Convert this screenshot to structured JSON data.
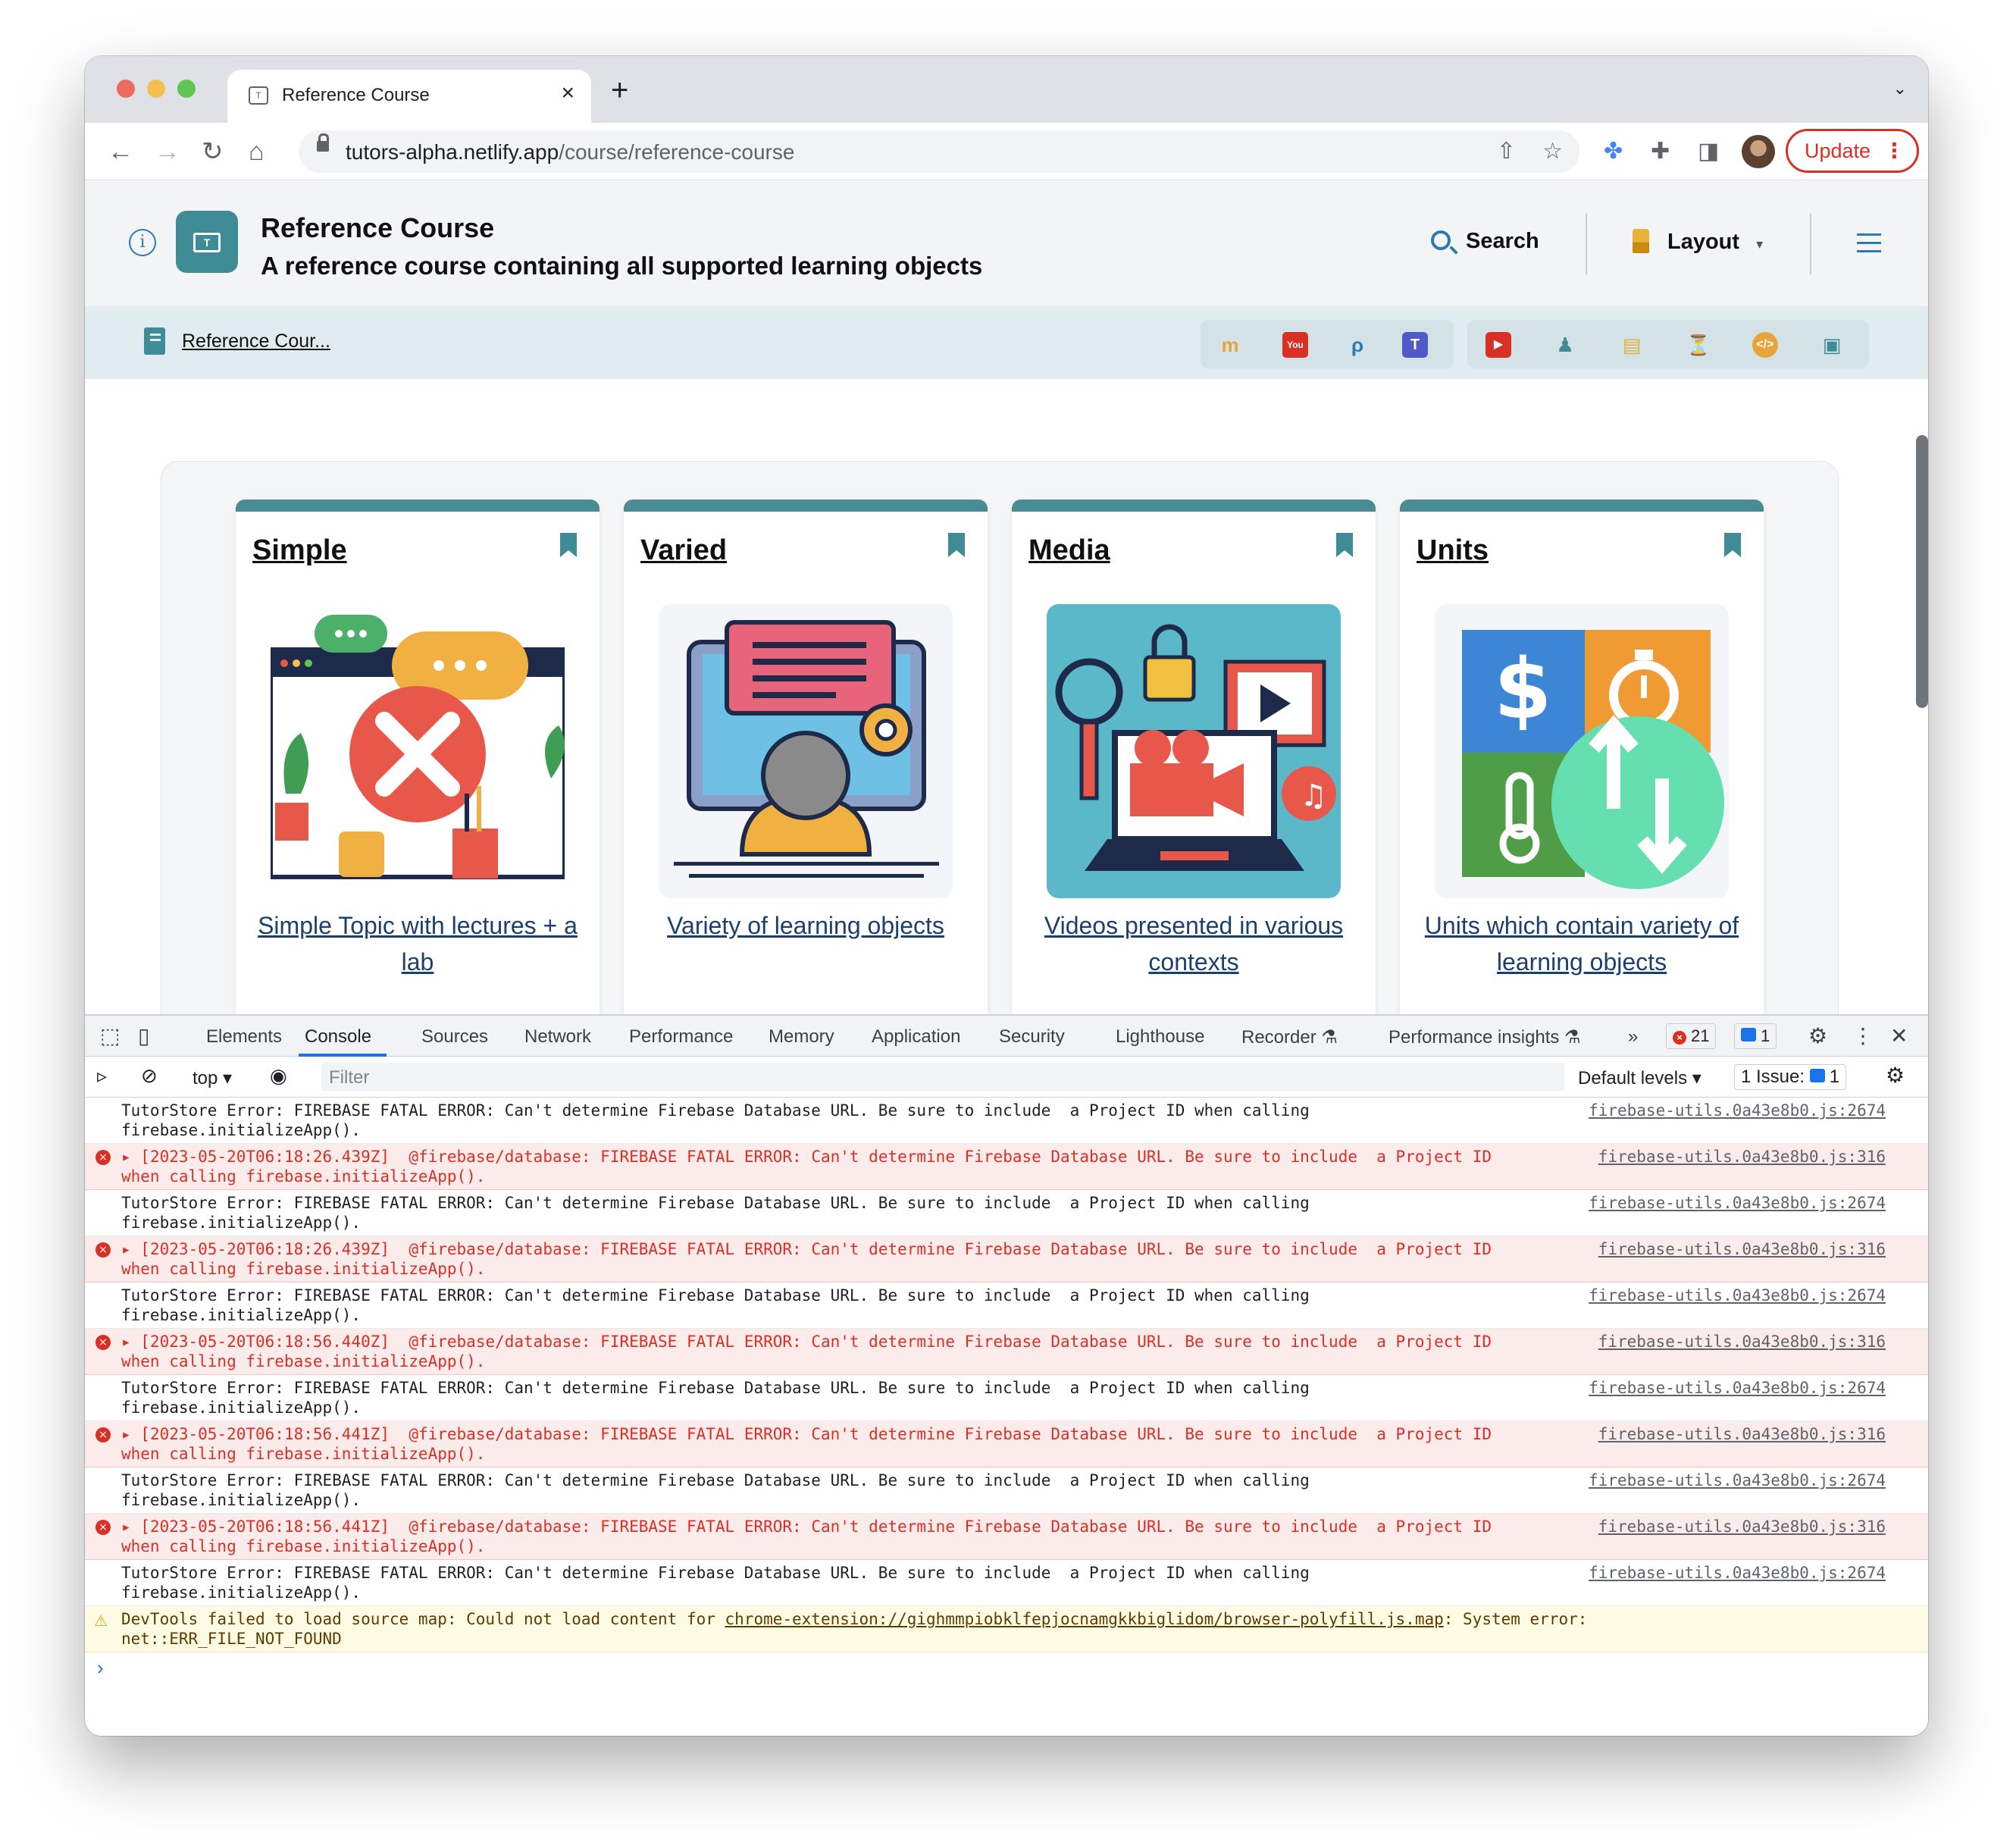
{
  "browser": {
    "tab_title": "Reference Course",
    "new_tab": "+",
    "url_host": "tutors-alpha.netlify.app",
    "url_path": "/course/reference-course",
    "update_label": "Update",
    "update_dots": "⋮"
  },
  "header": {
    "title": "Reference Course",
    "subtitle": "A reference course containing all supported learning objects",
    "search_label": "Search",
    "layout_label": "Layout",
    "layout_caret": "▾"
  },
  "breadcrumb": {
    "label": "Reference Cour..."
  },
  "cards": [
    {
      "title": "Simple",
      "desc": "Simple Topic with lectures + a lab"
    },
    {
      "title": "Varied",
      "desc": "Variety of learning objects"
    },
    {
      "title": "Media",
      "desc": "Videos presented in various contexts"
    },
    {
      "title": "Units",
      "desc": "Units which contain variety of learning objects"
    }
  ],
  "devtools": {
    "tabs": [
      "Elements",
      "Console",
      "Sources",
      "Network",
      "Performance",
      "Memory",
      "Application",
      "Security",
      "Lighthouse",
      "Recorder",
      "Performance insights"
    ],
    "error_count": "21",
    "message_count": "1",
    "context": "top",
    "filter_placeholder": "Filter",
    "levels": "Default levels",
    "issues_label": "1 Issue:",
    "issues_count": "1",
    "more_tabs": "»"
  },
  "console": {
    "tutor_line1": "TutorStore Error: FIREBASE FATAL ERROR: Can't determine Firebase Database URL. Be sure to include  a Project ID when calling",
    "tutor_line2": "firebase.initializeApp().",
    "tutor_src": "firebase-utils.0a43e8b0.js:2674",
    "err_rest1": "  @firebase/database: FIREBASE FATAL ERROR: Can't determine Firebase Database URL. Be sure to include  a Project ID",
    "err_line2": "when calling firebase.initializeApp().",
    "err_src": "firebase-utils.0a43e8b0.js:316",
    "err_times": [
      "[2023-05-20T06:18:26.439Z]",
      "[2023-05-20T06:18:26.439Z]",
      "[2023-05-20T06:18:56.440Z]",
      "[2023-05-20T06:18:56.441Z]",
      "[2023-05-20T06:18:56.441Z]"
    ],
    "warn_prefix": "DevTools failed to load source map: Could not load content for ",
    "warn_link": "chrome-extension://gighmmpiobklfepjocnamgkkbiglidom/browser-polyfill.js.map",
    "warn_suffix": ": System error:",
    "warn_line2": "net::ERR_FILE_NOT_FOUND",
    "prompt": "›"
  },
  "colors": {
    "accent": "#3f8c96",
    "error": "#d93025",
    "link": "#1c3f6e"
  }
}
